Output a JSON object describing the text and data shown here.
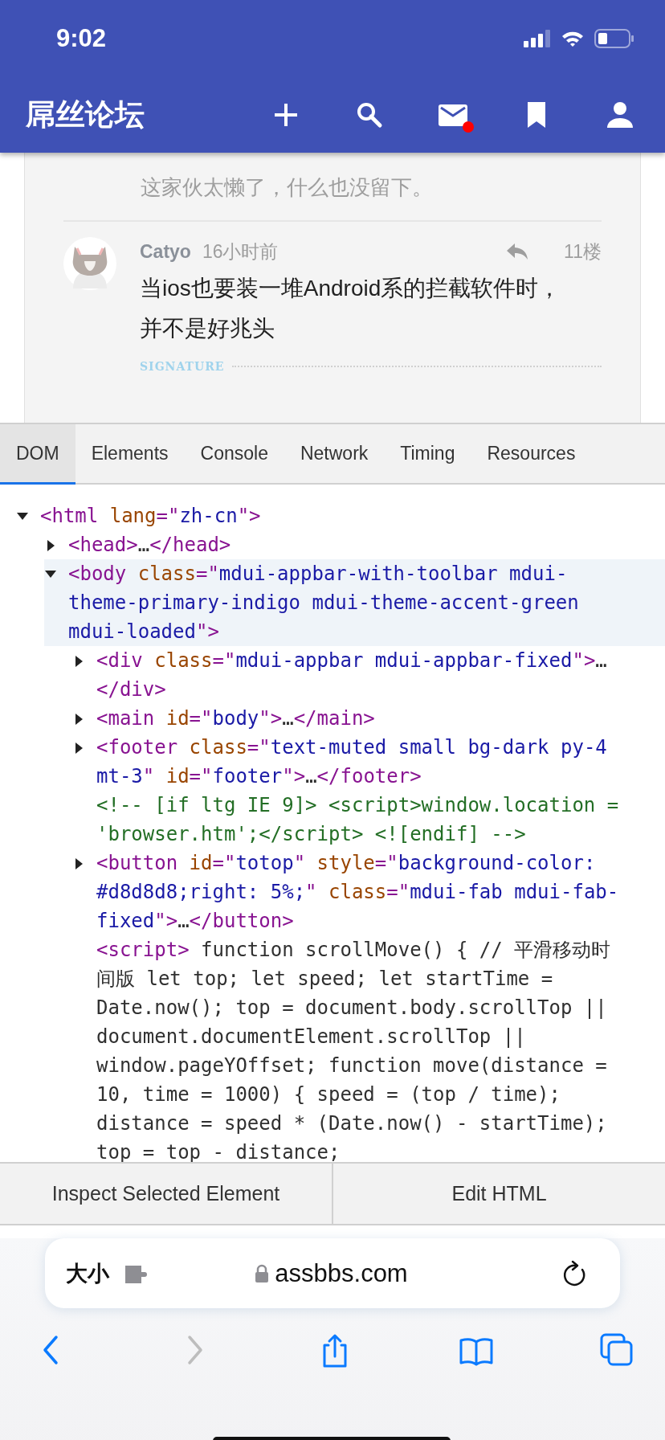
{
  "status_bar": {
    "time": "9:02"
  },
  "app_bar": {
    "title": "屌丝论坛",
    "actions": [
      {
        "kind": "plus",
        "badge": false
      },
      {
        "kind": "search",
        "badge": false
      },
      {
        "kind": "mail",
        "badge": true
      },
      {
        "kind": "bookmark",
        "badge": false
      },
      {
        "kind": "account",
        "badge": false
      }
    ]
  },
  "post": {
    "previous_signature": "这家伙太懒了，什么也没留下。",
    "author": "Catyo",
    "time": "16小时前",
    "floor": "11楼",
    "body": "当ios也要装一堆Android系的拦截软件时，并不是好兆头",
    "signature_label": "SIGNATURE"
  },
  "devtools": {
    "tabs": [
      {
        "label": "DOM",
        "selected": true
      },
      {
        "label": "Elements",
        "selected": false
      },
      {
        "label": "Console",
        "selected": false
      },
      {
        "label": "Network",
        "selected": false
      },
      {
        "label": "Timing",
        "selected": false
      },
      {
        "label": "Resources",
        "selected": false
      }
    ],
    "tree": [
      {
        "kind": "toggle",
        "expanded": true,
        "selected": false,
        "lines": [
          [
            {
              "kind": "tag",
              "text": "<html "
            },
            {
              "kind": "attr",
              "text": "lang"
            },
            {
              "kind": "tag",
              "text": "=\""
            },
            {
              "kind": "value",
              "text": "zh-cn"
            },
            {
              "kind": "tag",
              "text": "\">"
            }
          ]
        ],
        "children": [
          {
            "kind": "toggle",
            "expanded": false,
            "selected": false,
            "lines": [
              [
                {
                  "kind": "tag",
                  "text": "<head>"
                },
                {
                  "kind": "plain",
                  "text": "…"
                },
                {
                  "kind": "tag",
                  "text": "</head>"
                }
              ]
            ]
          },
          {
            "kind": "toggle",
            "expanded": true,
            "selected": true,
            "lines": [
              [
                {
                  "kind": "tag",
                  "text": "<body "
                },
                {
                  "kind": "attr",
                  "text": "class"
                },
                {
                  "kind": "tag",
                  "text": "=\""
                },
                {
                  "kind": "value",
                  "text": "mdui-appbar-with-toolbar mdui-"
                }
              ],
              [
                {
                  "kind": "value",
                  "text": "theme-primary-indigo mdui-theme-accent-green"
                }
              ],
              [
                {
                  "kind": "value",
                  "text": "mdui-loaded"
                },
                {
                  "kind": "tag",
                  "text": "\">"
                }
              ]
            ],
            "children": [
              {
                "kind": "toggle",
                "expanded": false,
                "selected": false,
                "lines": [
                  [
                    {
                      "kind": "tag",
                      "text": "<div "
                    },
                    {
                      "kind": "attr",
                      "text": "class"
                    },
                    {
                      "kind": "tag",
                      "text": "=\""
                    },
                    {
                      "kind": "value",
                      "text": "mdui-appbar mdui-appbar-fixed"
                    },
                    {
                      "kind": "tag",
                      "text": "\">"
                    },
                    {
                      "kind": "plain",
                      "text": "…"
                    }
                  ],
                  [
                    {
                      "kind": "tag",
                      "text": "</div>"
                    }
                  ]
                ]
              },
              {
                "kind": "toggle",
                "expanded": false,
                "selected": false,
                "lines": [
                  [
                    {
                      "kind": "tag",
                      "text": "<main "
                    },
                    {
                      "kind": "attr",
                      "text": "id"
                    },
                    {
                      "kind": "tag",
                      "text": "=\""
                    },
                    {
                      "kind": "value",
                      "text": "body"
                    },
                    {
                      "kind": "tag",
                      "text": "\">"
                    },
                    {
                      "kind": "plain",
                      "text": "…"
                    },
                    {
                      "kind": "tag",
                      "text": "</main>"
                    }
                  ]
                ]
              },
              {
                "kind": "toggle",
                "expanded": false,
                "selected": false,
                "lines": [
                  [
                    {
                      "kind": "tag",
                      "text": "<footer "
                    },
                    {
                      "kind": "attr",
                      "text": "class"
                    },
                    {
                      "kind": "tag",
                      "text": "=\""
                    },
                    {
                      "kind": "value",
                      "text": "text-muted small bg-dark py-4"
                    }
                  ],
                  [
                    {
                      "kind": "value",
                      "text": "mt-3"
                    },
                    {
                      "kind": "tag",
                      "text": "\" "
                    },
                    {
                      "kind": "attr",
                      "text": "id"
                    },
                    {
                      "kind": "tag",
                      "text": "=\""
                    },
                    {
                      "kind": "value",
                      "text": "footer"
                    },
                    {
                      "kind": "tag",
                      "text": "\">"
                    },
                    {
                      "kind": "plain",
                      "text": "…"
                    },
                    {
                      "kind": "tag",
                      "text": "</footer>"
                    }
                  ]
                ]
              },
              {
                "kind": "leaf",
                "selected": false,
                "lines": [
                  [
                    {
                      "kind": "comment",
                      "text": "<!-- [if ltg IE 9]> <script>window.location ="
                    }
                  ],
                  [
                    {
                      "kind": "comment",
                      "text": "'browser.htm';</script> <![endif] -->"
                    }
                  ]
                ]
              },
              {
                "kind": "toggle",
                "expanded": false,
                "selected": false,
                "lines": [
                  [
                    {
                      "kind": "tag",
                      "text": "<button "
                    },
                    {
                      "kind": "attr",
                      "text": "id"
                    },
                    {
                      "kind": "tag",
                      "text": "=\""
                    },
                    {
                      "kind": "value",
                      "text": "totop"
                    },
                    {
                      "kind": "tag",
                      "text": "\" "
                    },
                    {
                      "kind": "attr",
                      "text": "style"
                    },
                    {
                      "kind": "tag",
                      "text": "=\""
                    },
                    {
                      "kind": "value",
                      "text": "background-color:"
                    }
                  ],
                  [
                    {
                      "kind": "value",
                      "text": "#d8d8d8;right: 5%;"
                    },
                    {
                      "kind": "tag",
                      "text": "\" "
                    },
                    {
                      "kind": "attr",
                      "text": "class"
                    },
                    {
                      "kind": "tag",
                      "text": "=\""
                    },
                    {
                      "kind": "value",
                      "text": "mdui-fab mdui-fab-"
                    }
                  ],
                  [
                    {
                      "kind": "value",
                      "text": "fixed"
                    },
                    {
                      "kind": "tag",
                      "text": "\">"
                    },
                    {
                      "kind": "plain",
                      "text": "…"
                    },
                    {
                      "kind": "tag",
                      "text": "</button>"
                    }
                  ]
                ]
              },
              {
                "kind": "leaf",
                "selected": false,
                "lines": [
                  [
                    {
                      "kind": "tag",
                      "text": "<script>"
                    },
                    {
                      "kind": "plain",
                      "text": " function scrollMove() { // 平滑移动时"
                    }
                  ],
                  [
                    {
                      "kind": "plain",
                      "text": "间版 let top; let speed; let startTime ="
                    }
                  ],
                  [
                    {
                      "kind": "plain",
                      "text": "Date.now(); top = document.body.scrollTop ||"
                    }
                  ],
                  [
                    {
                      "kind": "plain",
                      "text": "document.documentElement.scrollTop ||"
                    }
                  ],
                  [
                    {
                      "kind": "plain",
                      "text": "window.pageYOffset; function move(distance ="
                    }
                  ],
                  [
                    {
                      "kind": "plain",
                      "text": "10, time = 1000) { speed = (top / time);"
                    }
                  ],
                  [
                    {
                      "kind": "plain",
                      "text": "distance = speed * (Date.now() - startTime);"
                    }
                  ],
                  [
                    {
                      "kind": "plain",
                      "text": "top = top - distance;"
                    }
                  ]
                ]
              }
            ]
          }
        ]
      }
    ],
    "buttons": [
      "Inspect Selected Element",
      "Edit HTML"
    ]
  },
  "browser": {
    "text_size_label": "大小",
    "url": "assbbs.com",
    "toolbar": [
      {
        "kind": "back",
        "disabled": false
      },
      {
        "kind": "forward",
        "disabled": true
      },
      {
        "kind": "share",
        "disabled": false
      },
      {
        "kind": "bookmarks",
        "disabled": false
      },
      {
        "kind": "tabs",
        "disabled": false
      }
    ]
  }
}
